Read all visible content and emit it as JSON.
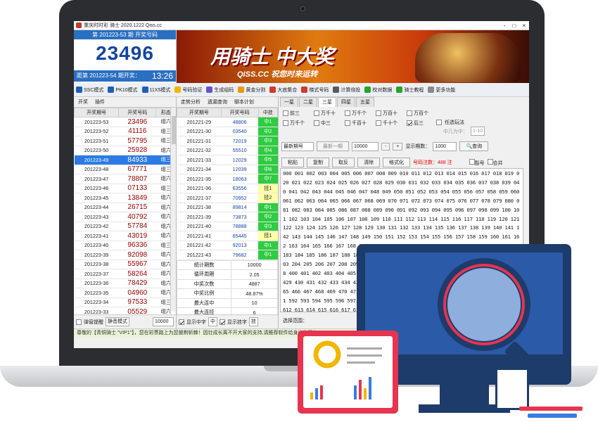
{
  "window": {
    "title": "重庆时时彩 骑士 2020.1222 Qiss.cc",
    "buttons": [
      "-",
      "□",
      "×"
    ]
  },
  "draw": {
    "header": "第 201223-53 期 开奖号码",
    "number": "23496",
    "next_label": "距第 201223-54 期开奖：",
    "next_time": "13:26"
  },
  "banner": {
    "title": "用骑士 中大奖",
    "subtitle": "QISS.CC 祝您时来运转"
  },
  "toolbar": [
    {
      "label": "SSC模式",
      "icon": "lottery-icon",
      "color": "#1e5fb4"
    },
    {
      "label": "PK10模式",
      "icon": "lottery-icon",
      "color": "#1e5fb4"
    },
    {
      "label": "11X5模式",
      "icon": "lottery-icon",
      "color": "#1e5fb4"
    },
    {
      "label": "号码验证",
      "icon": "verify-icon",
      "color": "#f2b600"
    },
    {
      "label": "生成组码",
      "icon": "generate-icon",
      "color": "#6a4fd1"
    },
    {
      "label": "黄金分割",
      "icon": "gold-icon",
      "color": "#e89a10"
    },
    {
      "label": "大底集合",
      "icon": "collection-icon",
      "color": "#d23a2a"
    },
    {
      "label": "梯式号码",
      "icon": "ladder-icon",
      "color": "#d23a2a"
    },
    {
      "label": "计算倍投",
      "icon": "calculator-icon",
      "color": "#5a5a5a"
    },
    {
      "label": "校对数据",
      "icon": "check-data-icon",
      "color": "#2ca02c"
    },
    {
      "label": "骑士教程",
      "icon": "tutorial-icon",
      "color": "#2ca02c"
    },
    {
      "label": "更多功能",
      "icon": "more-icon",
      "color": "#888888"
    }
  ],
  "left": {
    "tabs": [
      "开奖",
      "插件"
    ],
    "headers": [
      "开奖期号",
      "开奖号码",
      "形态"
    ],
    "rows": [
      [
        "201223-53",
        "23496",
        "组六"
      ],
      [
        "201223-52",
        "41116",
        "组三"
      ],
      [
        "201223-51",
        "57795",
        "组三"
      ],
      [
        "201223-50",
        "25928",
        "组六"
      ],
      [
        "201223-49",
        "84933",
        "组三"
      ],
      [
        "201223-48",
        "67771",
        "组三"
      ],
      [
        "201223-47",
        "78807",
        "组六"
      ],
      [
        "201223-46",
        "07133",
        "组三"
      ],
      [
        "201223-45",
        "13849",
        "组六"
      ],
      [
        "201223-44",
        "26715",
        "组六"
      ],
      [
        "201223-43",
        "40792",
        "组六"
      ],
      [
        "201223-42",
        "57784",
        "组六"
      ],
      [
        "201223-41",
        "43019",
        "组六"
      ],
      [
        "201223-40",
        "96336",
        "组三"
      ],
      [
        "201223-39",
        "92098",
        "组六"
      ],
      [
        "201223-38",
        "55967",
        "组六"
      ],
      [
        "201223-37",
        "58264",
        "组六"
      ],
      [
        "201223-36",
        "78429",
        "组六"
      ],
      [
        "201223-35",
        "04960",
        "组六"
      ],
      [
        "201223-34",
        "97533",
        "组三"
      ],
      [
        "201223-33",
        "05529",
        "组六"
      ]
    ],
    "selected": 4,
    "foot": {
      "alert": "弹窗提醒",
      "mode": "静音模式",
      "count": "10000"
    }
  },
  "mid": {
    "tabs": [
      "走势分析",
      "遗漏查询",
      "聊本计划"
    ],
    "headers": [
      "开奖期号",
      "开奖号码",
      "中挂"
    ],
    "rows": [
      [
        "201221-29",
        "48806",
        "中1",
        "g"
      ],
      [
        "201221-30",
        "03540",
        "中2",
        "g"
      ],
      [
        "201221-31",
        "72019",
        "中3",
        "g"
      ],
      [
        "201221-32",
        "55510",
        "中4",
        "g"
      ],
      [
        "201221-33",
        "12029",
        "中5",
        "g"
      ],
      [
        "201221-34",
        "12039",
        "中6",
        "g"
      ],
      [
        "201221-35",
        "18063",
        "中7",
        "g"
      ],
      [
        "201221-36",
        "63556",
        "挂1",
        "y"
      ],
      [
        "201221-37",
        "70952",
        "挂2",
        "y"
      ],
      [
        "201221-38",
        "89814",
        "中1",
        "g"
      ],
      [
        "201221-39",
        "73873",
        "中2",
        "g"
      ],
      [
        "201221-40",
        "78888",
        "中3",
        "g"
      ],
      [
        "201221-41",
        "65445",
        "挂1",
        "y"
      ],
      [
        "201221-42",
        "92013",
        "中1",
        "g"
      ],
      [
        "201221-43",
        "79682",
        "中1",
        "g"
      ]
    ],
    "stats": [
      [
        "统计期数",
        "10000"
      ],
      [
        "循环周期",
        "2.05"
      ],
      [
        "中奖次数",
        "4887"
      ],
      [
        "中奖比例",
        "48.87%"
      ],
      [
        "最大连中",
        "10"
      ],
      [
        "最大连挂",
        "6"
      ]
    ],
    "foot": {
      "show_hit": "显示中字",
      "hit": "中",
      "show_miss": "显示挂字",
      "miss": "挂"
    }
  },
  "right": {
    "tabs": [
      "一星",
      "二星",
      "三星",
      "四星",
      "五星"
    ],
    "active_tab": 2,
    "checks_row1": [
      "前三",
      "万千十",
      "万千个",
      "万百十",
      "万百个"
    ],
    "checks_row2": [
      "万千个",
      "中三",
      "千百十",
      "千十个",
      "后三"
    ],
    "checks_on": "后三",
    "filter": {
      "label": "任选玩法",
      "hint": "中几为中：",
      "range": "1-10"
    },
    "query": {
      "select": "最新期号",
      "latest": "最新一期",
      "count": "10000",
      "show_periods": "显示期数：",
      "periods": "1000",
      "button": "查询"
    },
    "actions": [
      "粘贴",
      "复制",
      "取反",
      "清除",
      "格式化"
    ],
    "note_count": "号码注数：488 注",
    "opt1": "豁号",
    "opt2": "合并",
    "codes": "000 001 002 003 004 005 006 007 008 009 010 011 012 013 014 015 016 017 018 019 020 021 022 023 024 025 026 027 028 029 030 031 032 033 034 035 036 037 038 039 040 041 042 043 044 045 046 047 048 049 050 051 052 053 054 055 056 057 058 059 060 061 062 063 064 065 066 067 068 069 070 071 072 073 074 075 076 077 078 079 080 081 082 083 084 085 086 087 088 089 090 091 092 093 094 095 096 097 098 099 100 101 102 103 104 105 106 107 108 109 110 111 112 113 114 115 116 117 118 119 120 121 122 123 124 125 126 127 128 129 130 131 132 133 134 135 136 137 138 139 140 141 142 143 144 145 146 147 148 149 150 151 152 153 154 155 156 157 158 159 160 161 162 163 164 165 166 167 168 169 170 171 172 173 174 175 176 177 178 179 180 181 182 183 184 185 186 187 188 189 190 191 192 193 194 195 196 197 198 199 200 201 202 203 204 205 206 207 208 209 210 211 212 213 214 215 216 217 218 219 220 221 222 398 400 401 402 403 404 405 406 407 408 409 410 417 418 419 420 421 422 426 427 428 429 430 431 432 433 434 435 436 442 443 444 445 446 447 448 449 450 451 452 453 465 466 467 468 469 470 471 472 473 474 475 476 477 478 479 480 481 588 589 590 591 592 593 594 595 596 597 598 599 600 601 602 603 604 605 606 607 608 609 610 611 612 613 614 615 616 617 618 619 620 621 622 623 624 625 626 627 628 629 630 631 632 633 634 635 636 637 638 639 640 641 642 706 707 708 709 710 711 712 713 714 715 716 717 718 719 720 721 722 723 724 725 726 727 728 729 730 731 732",
    "range_label": "选择范围："
  },
  "status": "尊敬的【青铜骑士 \"VIP1\"】，您在彩票路上为您披荆斩棘！因壮成长离不开大家的支持,请推荐软件给身边的朋友"
}
